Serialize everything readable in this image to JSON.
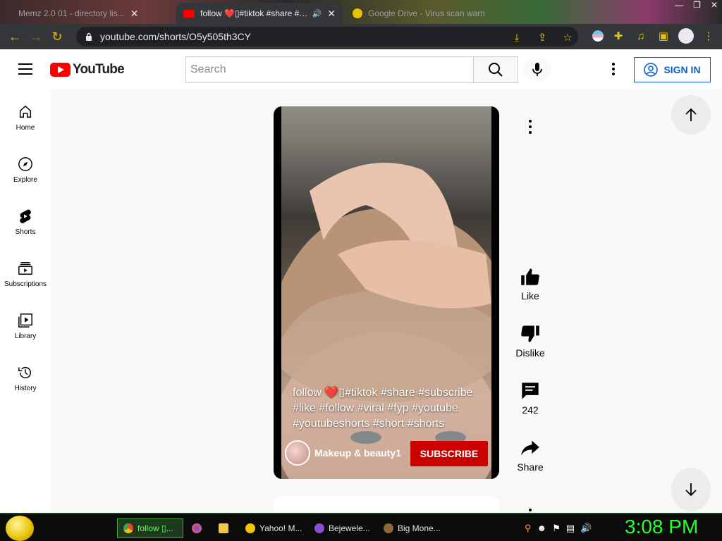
{
  "browser": {
    "tabs": [
      {
        "title": "Memz 2.0 01 - directory lis...",
        "active": false
      },
      {
        "title": "follow ❤️▯#tiktok #share #s...",
        "active": true
      },
      {
        "title": "Google Drive - Virus scan warn",
        "active": false
      }
    ],
    "url": "youtube.com/shorts/O5y505th3CY",
    "accent_color": "#e8c300"
  },
  "header": {
    "logo_text": "YouTube",
    "search_placeholder": "Search",
    "sign_in_label": "SIGN IN"
  },
  "guide": {
    "items": [
      {
        "label": "Home",
        "icon": "home-icon"
      },
      {
        "label": "Explore",
        "icon": "compass-icon"
      },
      {
        "label": "Shorts",
        "icon": "shorts-icon"
      },
      {
        "label": "Subscriptions",
        "icon": "subscriptions-icon"
      },
      {
        "label": "Library",
        "icon": "library-icon"
      },
      {
        "label": "History",
        "icon": "history-icon"
      }
    ]
  },
  "video": {
    "caption": "follow ❤️▯#tiktok #share #subscribe #like #follow #viral #fyp #youtube #youtubeshorts #short #shorts",
    "channel_name": "Makeup & beauty1",
    "subscribe_label": "SUBSCRIBE",
    "subscribe_color": "#cc0000"
  },
  "actions": {
    "like_label": "Like",
    "dislike_label": "Dislike",
    "comments_count": "242",
    "share_label": "Share"
  },
  "taskbar": {
    "buttons": [
      {
        "label": "follow ▯...",
        "icon": "chrome-icon",
        "active": true
      },
      {
        "label": "",
        "icon": "firefox-icon"
      },
      {
        "label": "",
        "icon": "folder-icon"
      },
      {
        "label": "Yahoo! M...",
        "icon": "yahoo-messenger-icon"
      },
      {
        "label": "Bejewele...",
        "icon": "bejeweled-icon"
      },
      {
        "label": "Big Mone...",
        "icon": "big-money-icon"
      }
    ],
    "clock": "3:08 PM",
    "clock_color": "#29ff29"
  }
}
